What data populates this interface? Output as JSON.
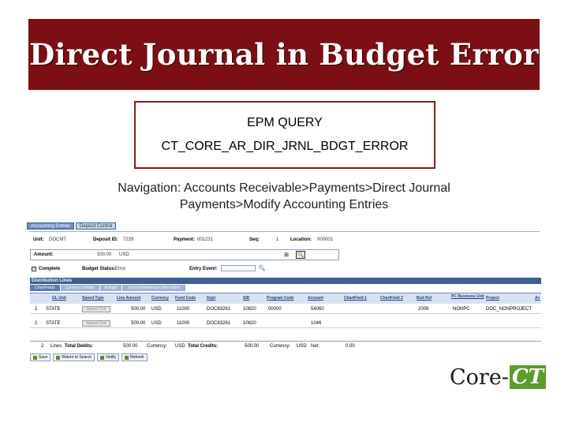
{
  "title": "Direct Journal in Budget Error",
  "query": {
    "line1": "EPM QUERY",
    "line2": "CT_CORE_AR_DIR_JRNL_BDGT_ERROR"
  },
  "navigation": {
    "line1": "Navigation: Accounts Receivable>Payments>Direct Journal",
    "line2": "Payments>Modify Accounting Entries"
  },
  "screen": {
    "tabs": [
      "Accounting Entries",
      "Deposit Control"
    ],
    "unit_label": "Unit:",
    "unit_value": "DOCMT",
    "deposit_id_label": "Deposit ID:",
    "deposit_id_value": "7229",
    "payment_label": "Payment:",
    "payment_value": "001231",
    "seq_label": "Seq:",
    "seq_value": "1",
    "location_label": "Location:",
    "location_value": "000001",
    "amount_label": "Amount:",
    "amount_value": "500.00",
    "amount_currency": "USD",
    "complete_label": "Complete",
    "budget_status_label": "Budget Status:",
    "budget_status_value": "Error",
    "entry_event_label": "Entry Event:",
    "grid_title": "Distribution Lines",
    "subtabs": [
      "ChartFields",
      "Currency Details",
      "Budget",
      "Journal Reference Information"
    ],
    "columns": [
      "GL Unit",
      "Speed Type",
      "Line Amount",
      "Currency",
      "Fund Code",
      "Dept",
      "SID",
      "Program Code",
      "Account",
      "ChartField 1",
      "ChartField 2",
      "Bud Ref",
      "PC Business Unit",
      "Project",
      "Ac"
    ],
    "rows": [
      {
        "num": "1",
        "gl_unit": "STATE",
        "speed": "Speed Chrt",
        "amount": "500.00",
        "currency": "USD",
        "fund": "11000",
        "dept": "DOC83261",
        "sid": "10820",
        "program": "00000",
        "account": "54060",
        "budref": "2009",
        "pcbu": "NONPC",
        "project": "DOC_NONPROJECT"
      },
      {
        "num": "2",
        "gl_unit": "STATE",
        "speed": "Speed Chrt",
        "amount": "500.00",
        "currency": "USD",
        "fund": "11000",
        "dept": "DOC83261",
        "sid": "10820",
        "program": "",
        "account": "1046",
        "budref": "",
        "pcbu": "",
        "project": ""
      }
    ],
    "totals": {
      "lines_value": "2",
      "lines_label": "Lines",
      "total_debits_label": "Total Debits:",
      "total_debits_value": "500.00",
      "currency_label": "Currency:",
      "currency_value": "USD",
      "total_credits_label": "Total Credits:",
      "total_credits_value": "500.00",
      "currency2_value": "USD",
      "net_label": "Net:",
      "net_value": "0.00"
    },
    "actions": [
      "Save",
      "Return to Search",
      "Notify",
      "Refresh"
    ]
  },
  "logo": {
    "core": "Core",
    "dash": "-",
    "ct": "CT"
  },
  "colors": {
    "title_bg": "#7b0f14",
    "query_border": "#8b1a1a",
    "logo_green": "#5c9c2a"
  }
}
